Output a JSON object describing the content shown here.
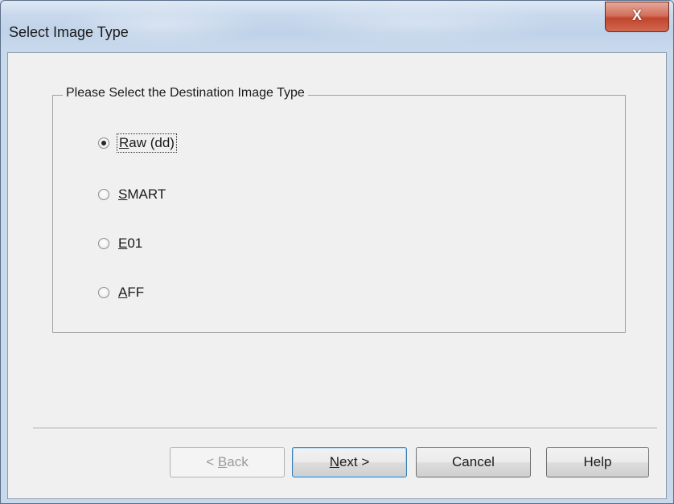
{
  "window": {
    "title": "Select Image Type",
    "close_icon": "close-icon",
    "close_glyph": "X"
  },
  "group": {
    "legend": "Please Select the Destination Image Type"
  },
  "options": [
    {
      "mnemonic": "R",
      "rest": "aw (dd)",
      "checked": true
    },
    {
      "mnemonic": "S",
      "rest": "MART",
      "checked": false
    },
    {
      "mnemonic": "E",
      "rest": "01",
      "checked": false
    },
    {
      "mnemonic": "A",
      "rest": "FF",
      "checked": false
    }
  ],
  "buttons": {
    "back": {
      "prefix": "< ",
      "mnemonic": "B",
      "rest": "ack",
      "enabled": false
    },
    "next": {
      "mnemonic": "N",
      "rest": "ext >"
    },
    "cancel": "Cancel",
    "help": "Help"
  }
}
